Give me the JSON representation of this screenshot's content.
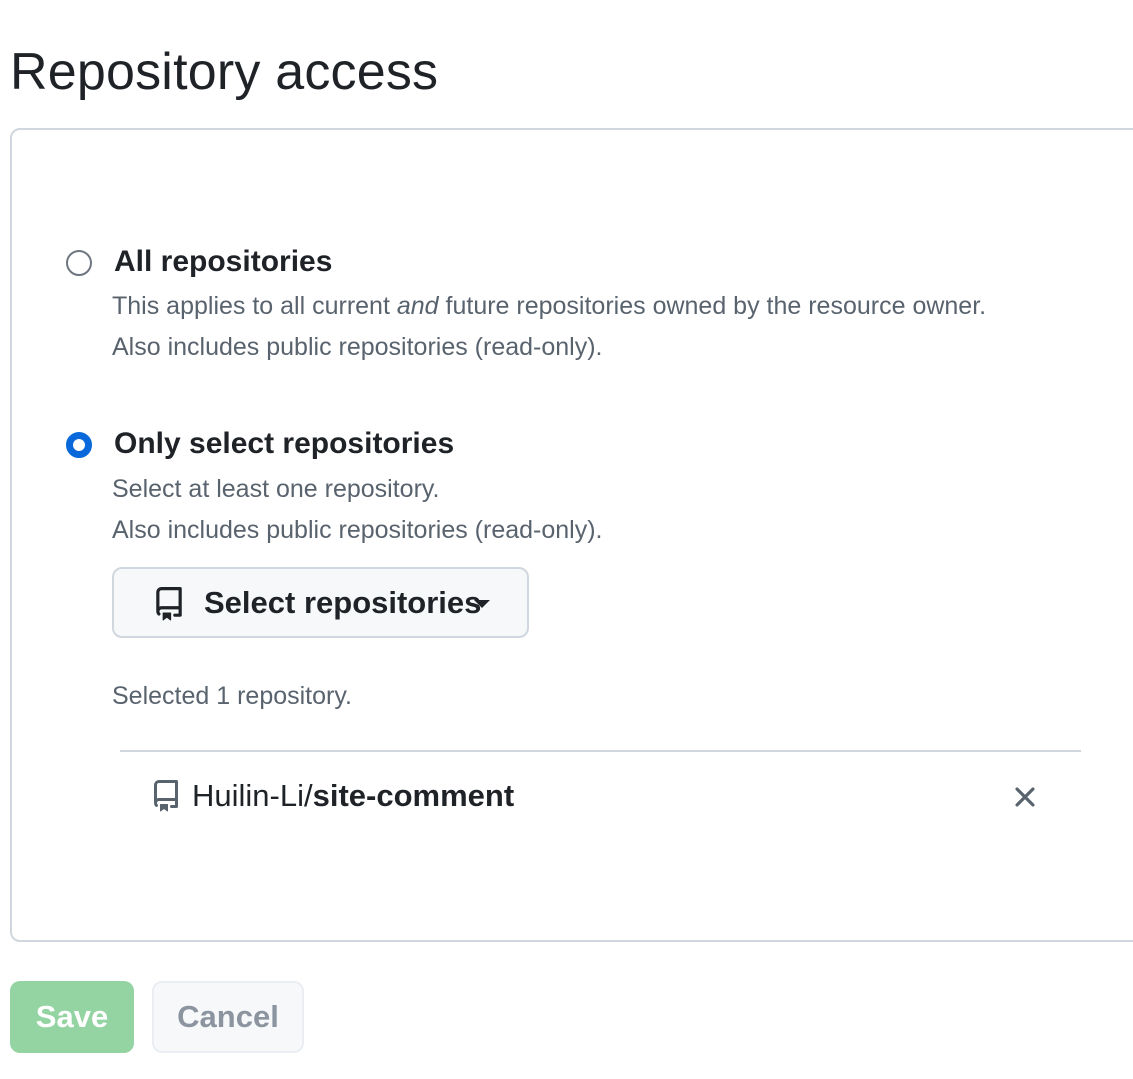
{
  "page": {
    "title": "Repository access"
  },
  "options": {
    "all": {
      "label": "All repositories",
      "note1_before": "This applies to all current ",
      "note1_em": "and",
      "note1_after": " future repositories owned by the resource owner.",
      "note2": "Also includes public repositories (read-only).",
      "checked": false
    },
    "select": {
      "label": "Only select repositories",
      "note1": "Select at least one repository.",
      "note2": "Also includes public repositories (read-only).",
      "checked": true
    }
  },
  "select_button": {
    "label": "Select repositories",
    "icon": "repo-icon"
  },
  "selected_count": "Selected 1 repository.",
  "repositories": [
    {
      "owner": "Huilin-Li/",
      "name": "site-comment",
      "icon": "repo-icon",
      "remove_icon": "x-icon"
    }
  ],
  "actions": {
    "save_label": "Save",
    "cancel_label": "Cancel"
  },
  "colors": {
    "accent": "#0969da",
    "save_disabled_bg": "#94d3a2",
    "border": "#d0d7de",
    "muted_text": "#59636e"
  }
}
